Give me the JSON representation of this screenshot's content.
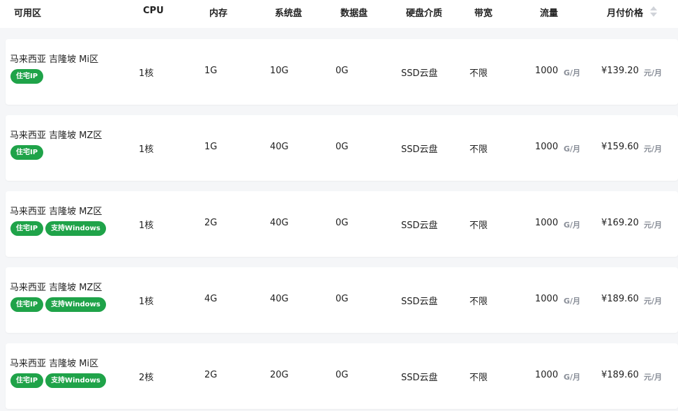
{
  "header": {
    "zone": "可用区",
    "cpu": "CPU",
    "memory": "内存",
    "system_disk": "系统盘",
    "data_disk": "数据盘",
    "disk_media": "硬盘介质",
    "bandwidth": "带宽",
    "traffic": "流量",
    "price": "月付价格"
  },
  "rows": [
    {
      "zone": "马来西亚 吉隆坡 Mi区",
      "badges": [
        "住宅IP"
      ],
      "cpu": "1核",
      "memory": "1G",
      "system_disk": "10G",
      "data_disk": "0G",
      "disk_media": "SSD云盘",
      "bandwidth": "不限",
      "traffic": "1000",
      "traffic_unit": "G/月",
      "price": "¥139.20",
      "price_unit": "元/月"
    },
    {
      "zone": "马来西亚 吉隆坡 MZ区",
      "badges": [
        "住宅IP"
      ],
      "cpu": "1核",
      "memory": "1G",
      "system_disk": "40G",
      "data_disk": "0G",
      "disk_media": "SSD云盘",
      "bandwidth": "不限",
      "traffic": "1000",
      "traffic_unit": "G/月",
      "price": "¥159.60",
      "price_unit": "元/月"
    },
    {
      "zone": "马来西亚 吉隆坡 MZ区",
      "badges": [
        "住宅IP",
        "支持Windows"
      ],
      "cpu": "1核",
      "memory": "2G",
      "system_disk": "40G",
      "data_disk": "0G",
      "disk_media": "SSD云盘",
      "bandwidth": "不限",
      "traffic": "1000",
      "traffic_unit": "G/月",
      "price": "¥169.20",
      "price_unit": "元/月"
    },
    {
      "zone": "马来西亚 吉隆坡 MZ区",
      "badges": [
        "住宅IP",
        "支持Windows"
      ],
      "cpu": "1核",
      "memory": "4G",
      "system_disk": "40G",
      "data_disk": "0G",
      "disk_media": "SSD云盘",
      "bandwidth": "不限",
      "traffic": "1000",
      "traffic_unit": "G/月",
      "price": "¥189.60",
      "price_unit": "元/月"
    },
    {
      "zone": "马来西亚 吉隆坡 Mi区",
      "badges": [
        "住宅IP",
        "支持Windows"
      ],
      "cpu": "2核",
      "memory": "2G",
      "system_disk": "20G",
      "data_disk": "0G",
      "disk_media": "SSD云盘",
      "bandwidth": "不限",
      "traffic": "1000",
      "traffic_unit": "G/月",
      "price": "¥189.60",
      "price_unit": "元/月"
    }
  ],
  "colors": {
    "badge_bg": "#1fa349",
    "unit_text": "#8a8f99",
    "sort_icon": "#d0d3d9"
  }
}
